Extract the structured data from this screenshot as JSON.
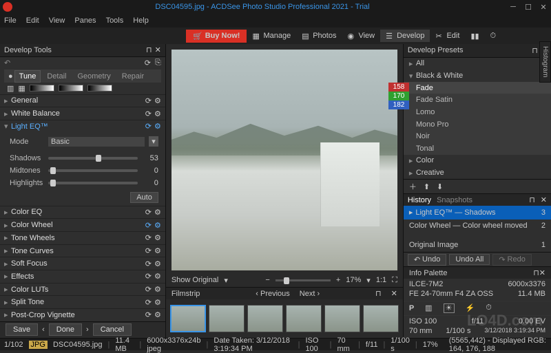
{
  "title": "DSC04595.jpg - ACDSee Photo Studio Professional 2021 - Trial",
  "menus": [
    "File",
    "Edit",
    "View",
    "Panes",
    "Tools",
    "Help"
  ],
  "buy": "Buy Now!",
  "modes": [
    "Manage",
    "Photos",
    "View",
    "Develop",
    "Edit"
  ],
  "left": {
    "header": "Develop Tools",
    "tabs": [
      "Tune",
      "Detail",
      "Geometry",
      "Repair"
    ],
    "sections": {
      "general": "General",
      "wb": "White Balance",
      "lighteq": "Light EQ™",
      "coloreq": "Color EQ",
      "colorwheel": "Color Wheel",
      "tonewheels": "Tone Wheels",
      "tonecurves": "Tone Curves",
      "softfocus": "Soft Focus",
      "effects": "Effects",
      "colorluts": "Color LUTs",
      "splittone": "Split Tone",
      "vignette": "Post-Crop Vignette"
    },
    "mode_label": "Mode",
    "mode_value": "Basic",
    "sliders": {
      "shadows": {
        "label": "Shadows",
        "value": "53",
        "pct": 53
      },
      "midtones": {
        "label": "Midtones",
        "value": "0",
        "pct": 2
      },
      "highlights": {
        "label": "Highlights",
        "value": "0",
        "pct": 2
      }
    },
    "auto": "Auto",
    "save": "Save",
    "done": "Done",
    "cancel": "Cancel"
  },
  "center": {
    "show_original": "Show Original",
    "zoom": "17%",
    "ratio": "1:1",
    "filmstrip": "Filmstrip",
    "previous": "Previous",
    "next": "Next"
  },
  "right": {
    "presets_header": "Develop Presets",
    "all": "All",
    "bw": "Black & White",
    "items": [
      "Fade",
      "Fade Satin",
      "Lomo",
      "Mono Pro",
      "Noir",
      "Tonal"
    ],
    "color": "Color",
    "creative": "Creative",
    "history_tab": "History",
    "snapshots_tab": "Snapshots",
    "hist": [
      {
        "label": "Light EQ™ — Shadows",
        "count": "3"
      },
      {
        "label": "Color Wheel — Color wheel moved",
        "count": "2"
      },
      {
        "label": "Original Image",
        "count": "1"
      }
    ],
    "undo": "Undo",
    "undoall": "Undo All",
    "redo": "Redo",
    "info_header": "Info Palette",
    "camera": "ILCE-7M2",
    "lens": "FE 24-70mm F4 ZA OSS",
    "dims": "6000x3376",
    "size": "11.4 MB",
    "p": "P",
    "iso_l": "ISO 100",
    "fl_l": "70 mm",
    "ap_l": "f/11",
    "ss_l": "1/100 s",
    "ev_l": "0.00 EV",
    "date_l": "3/12/2018 3:19:34 PM",
    "histogram_tab": "Histogram"
  },
  "rgb": {
    "r": "158",
    "g": "170",
    "b": "182"
  },
  "status": {
    "counter": "1/102",
    "badge": "JPG",
    "file": "DSC04595.jpg",
    "size": "11.4 MB",
    "dims": "6000x3376x24b jpeg",
    "date": "Date Taken: 3/12/2018 3:19:34 PM",
    "iso": "ISO 100",
    "fl": "70 mm",
    "ap": "f/11",
    "ss": "1/100 s",
    "zoom": "17%",
    "pixel": "(5565,442) - Displayed RGB: 164, 176, 188"
  },
  "watermark": "LO4D.com"
}
